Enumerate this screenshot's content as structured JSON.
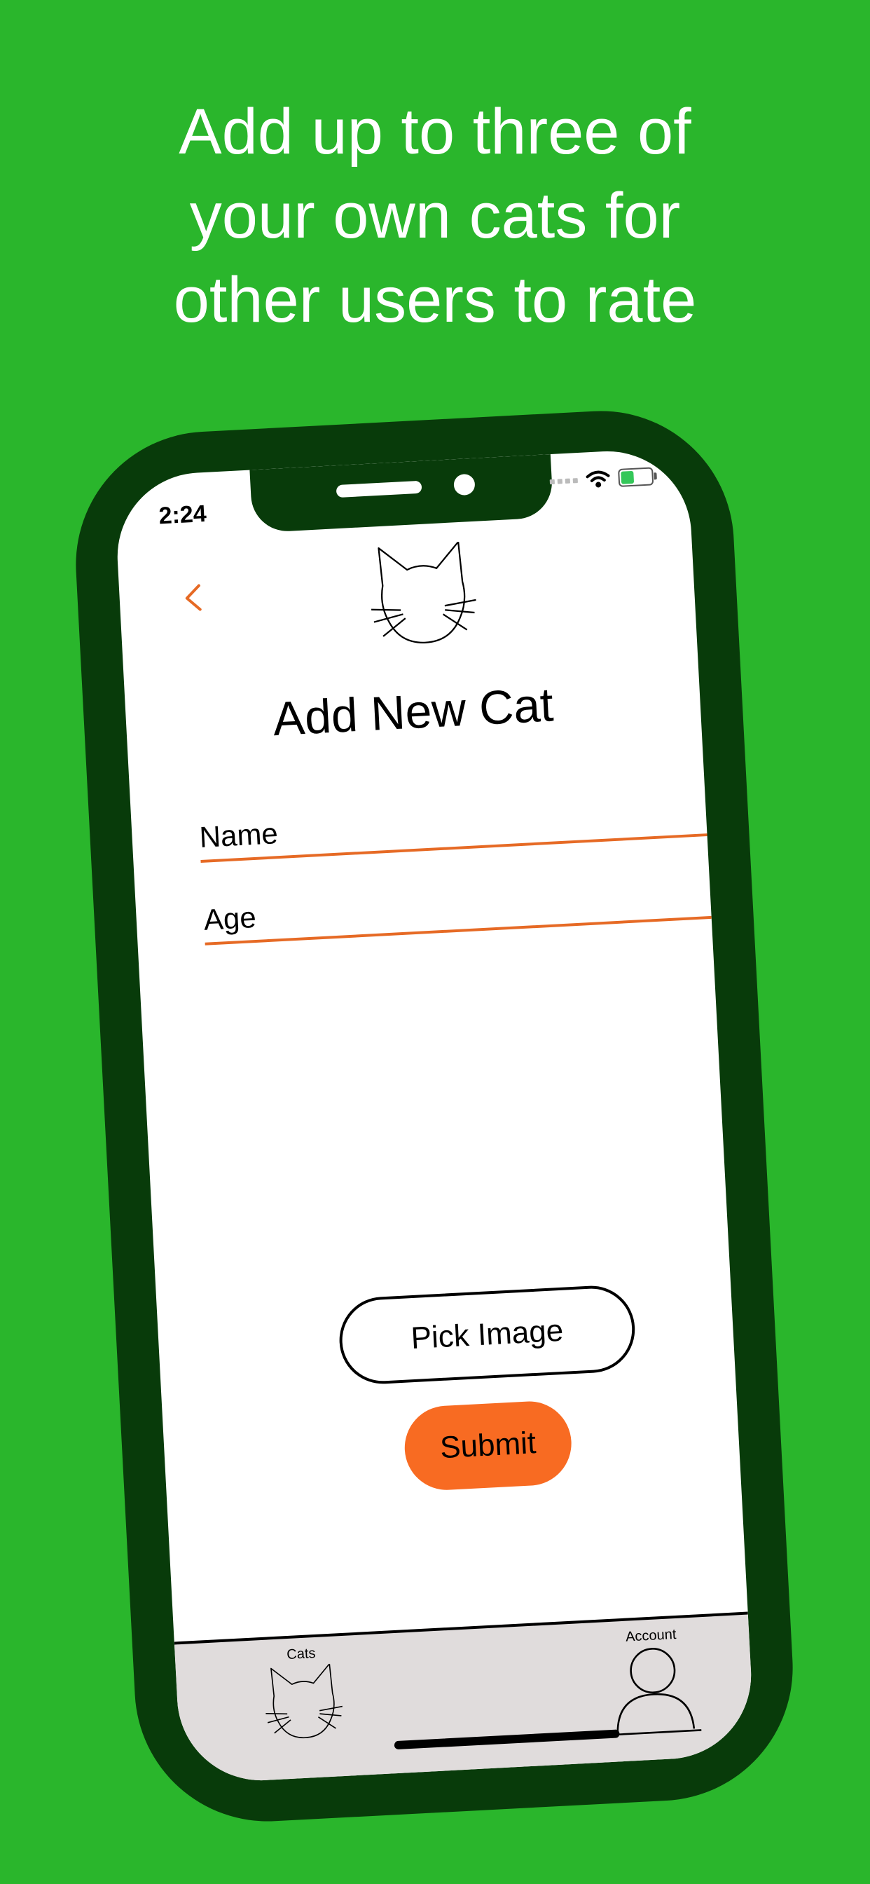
{
  "headline": {
    "lines": [
      "Add up to three of",
      "your own cats for",
      "other users to rate"
    ]
  },
  "status_bar": {
    "time": "2:24",
    "battery_level": 0.4
  },
  "screen": {
    "title": "Add New Cat",
    "name_placeholder": "Name",
    "age_placeholder": "Age",
    "pick_image_label": "Pick Image",
    "submit_label": "Submit"
  },
  "tab_bar": {
    "cats_label": "Cats",
    "account_label": "Account"
  },
  "colors": {
    "background": "#2ab62c",
    "phone_frame": "#083b0a",
    "accent": "#f86b22",
    "field_underline": "#e66a25",
    "tab_bar": "#e0dcdc"
  },
  "icons": {
    "back": "chevron-left-icon",
    "logo": "cat-face-icon",
    "cats_tab": "cat-face-icon",
    "account_tab": "person-icon",
    "wifi": "wifi-icon",
    "battery": "battery-charging-icon"
  }
}
